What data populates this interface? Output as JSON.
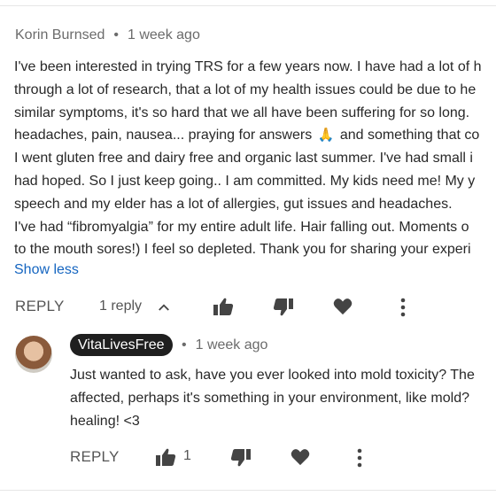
{
  "comment": {
    "author": "Korin Burnsed",
    "separator": "•",
    "time": "1 week ago",
    "lines": [
      "I've been interested in trying TRS for a few years now. I have had a lot of h",
      "through a lot of research, that a lot of my health issues could be due to he",
      "similar symptoms, it's so hard that we all have been suffering for so long. ",
      "headaches, pain, nausea... praying for answers",
      "and something that co",
      "I went gluten free and dairy free and organic last summer. I've had small i",
      "had hoped. So I just keep going.. I am committed. My kids need me! My y",
      "speech and my elder has a lot of allergies, gut issues and headaches.",
      "I've had “fibromyalgia” for my entire adult life. Hair falling out. Moments o",
      "to the mouth sores!) I feel so depleted. Thank you for sharing your experi"
    ],
    "emoji": "🙏",
    "show_less": "Show less",
    "reply_label": "REPLY",
    "replies_count": "1 reply"
  },
  "reply": {
    "author": "VitaLivesFree",
    "separator": "•",
    "time": "1 week ago",
    "lines": [
      "Just wanted to ask, have you ever looked into mold toxicity? The",
      "affected, perhaps it's something in your environment, like mold?",
      "healing! <3"
    ],
    "reply_label": "REPLY",
    "like_count": "1"
  },
  "icons": {
    "like": "thumb-up-icon",
    "dislike": "thumb-down-icon",
    "heart": "heart-icon",
    "more": "more-vert-icon",
    "chevron": "chevron-up-icon"
  }
}
